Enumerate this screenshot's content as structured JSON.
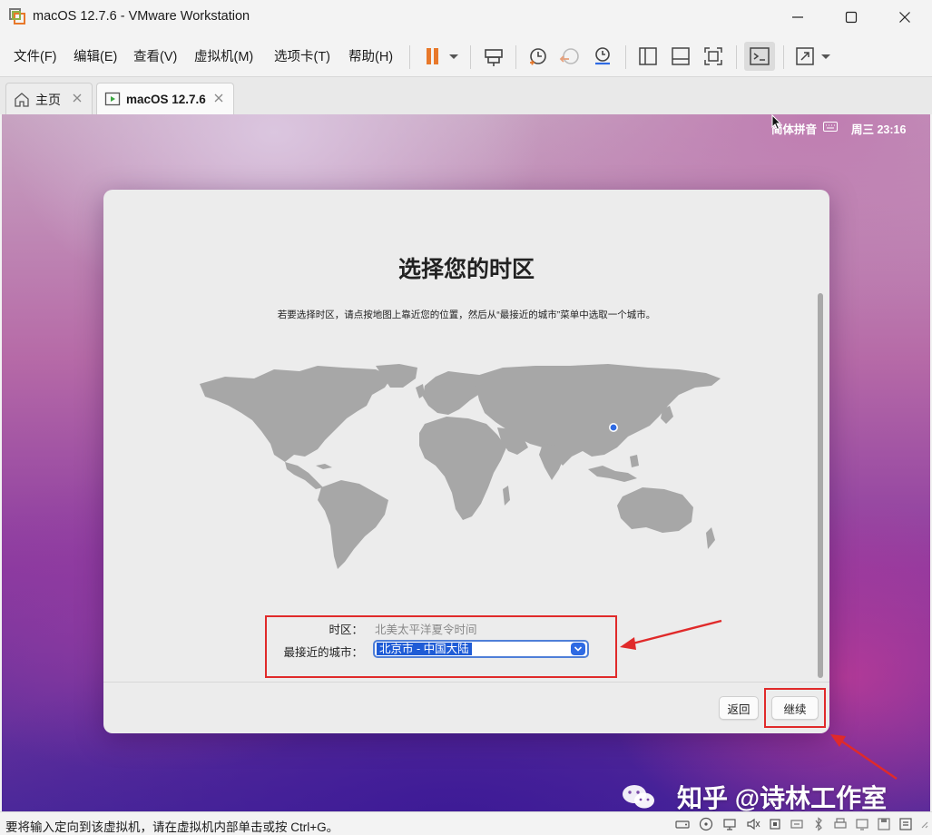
{
  "window": {
    "title": "macOS 12.7.6 - VMware Workstation"
  },
  "menu": {
    "items": [
      "文件(F)",
      "编辑(E)",
      "查看(V)",
      "虚拟机(M)",
      "选项卡(T)",
      "帮助(H)"
    ]
  },
  "tabs": [
    {
      "label": "主页",
      "icon": "home-icon"
    },
    {
      "label": "macOS 12.7.6",
      "icon": "vm-icon"
    }
  ],
  "guest": {
    "menu_extra": {
      "input_method": "简体拼音",
      "clock": "周三 23:16"
    },
    "dialog": {
      "title": "选择您的时区",
      "description": "若要选择时区，请点按地图上靠近您的位置，然后从“最接近的城市”菜单中选取一个城市。",
      "timezone_label": "时区：",
      "timezone_value": "北美太平洋夏令时间",
      "city_label": "最接近的城市：",
      "city_value": "北京市 - 中国大陆",
      "back_button": "返回",
      "continue_button": "继续"
    }
  },
  "overlay": {
    "watermark": "知乎 @诗林工作室",
    "annotation_color": "#e02a2a"
  },
  "statusbar": {
    "text": "要将输入定向到该虚拟机，请在虚拟机内部单击或按 Ctrl+G。"
  },
  "colors": {
    "pause_accent": "#e8782a",
    "select_accent": "#1f5cd6"
  }
}
